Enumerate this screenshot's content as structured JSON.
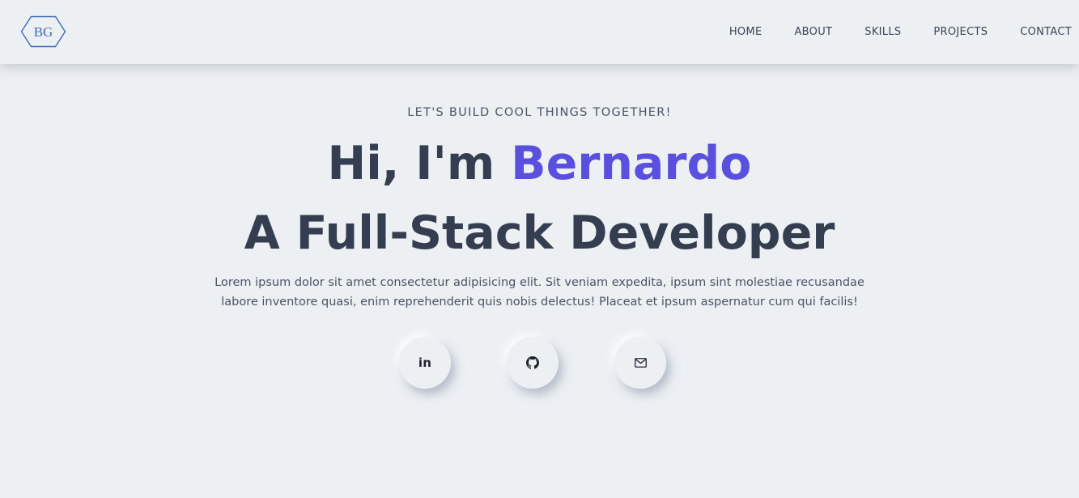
{
  "brand": {
    "logo_text": "BG",
    "logo_color": "#3f6bb3"
  },
  "nav": {
    "items": [
      "HOME",
      "ABOUT",
      "SKILLS",
      "PROJECTS",
      "CONTACT"
    ]
  },
  "hero": {
    "tagline": "LET'S BUILD COOL THINGS TOGETHER!",
    "greeting": "Hi, I'm ",
    "name": "Bernardo",
    "role": "A Full-Stack Developer",
    "intro": "Lorem ipsum dolor sit amet consectetur adipisicing elit. Sit veniam expedita, ipsum sint molestiae recusandae labore inventore quasi, enim reprehenderit quis nobis delectus! Placeat et ipsum aspernatur cum qui facilis!",
    "accent_color": "#5a4fdf"
  },
  "social": {
    "linkedin_label": "in",
    "linkedin_icon": "linkedin-icon",
    "github_icon": "github-icon",
    "mail_icon": "mail-icon"
  }
}
